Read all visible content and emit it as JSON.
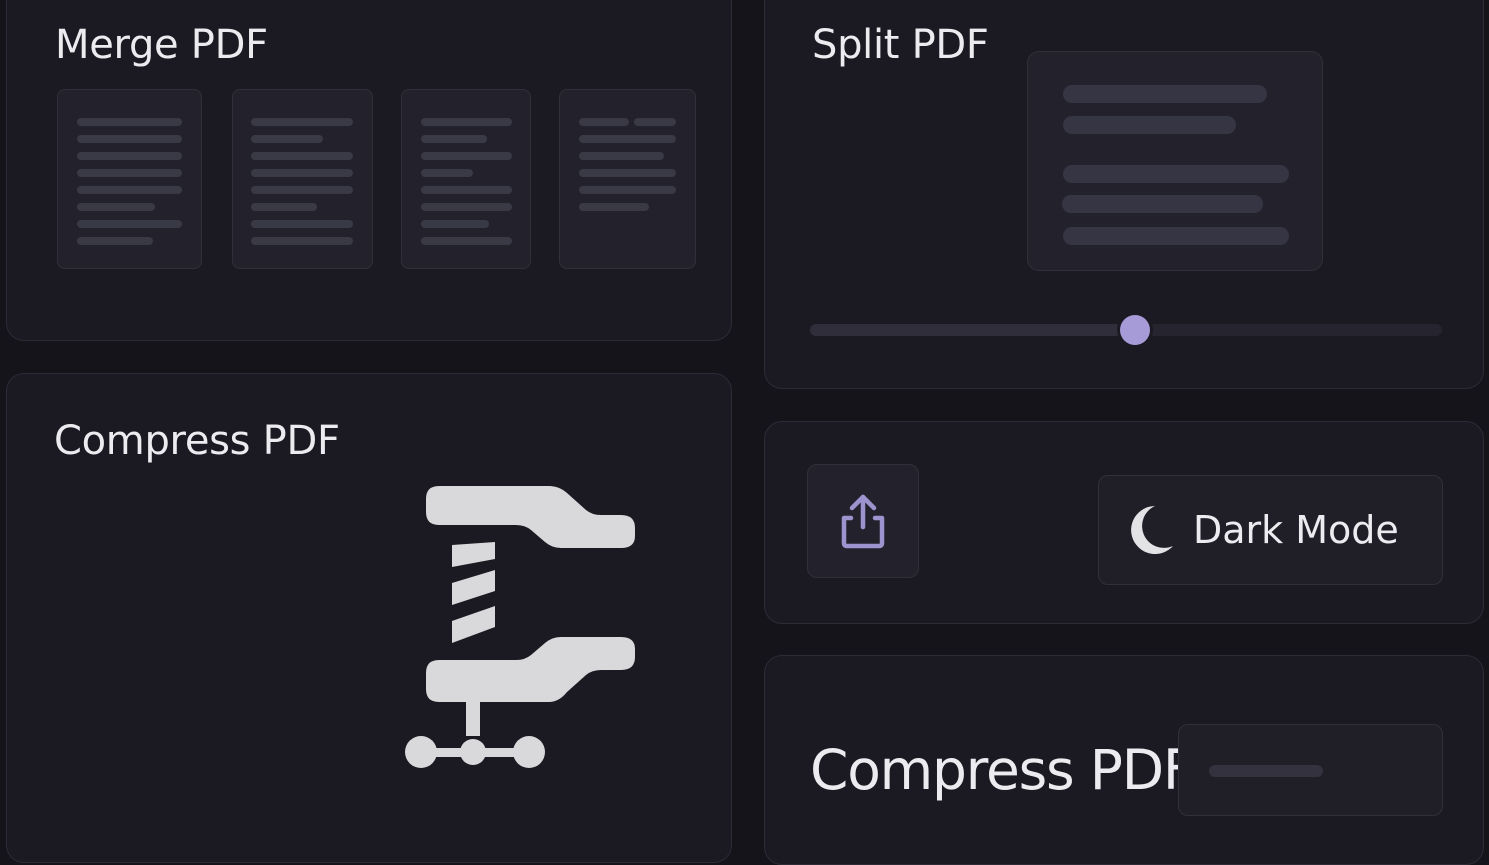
{
  "merge": {
    "title": "Merge PDF"
  },
  "split": {
    "title": "Split PDF",
    "slider_value_fraction": 0.515
  },
  "actions": {
    "share_icon": "share-upload-icon",
    "dark_mode_icon": "moon-icon",
    "dark_mode_label": "Dark Mode"
  },
  "compress": {
    "title": "Compress PDF",
    "icon": "clamp-compress-icon"
  },
  "compress_footer": {
    "title": "Compress PDF"
  },
  "colors": {
    "background": "#15141b",
    "card": "#1b1a22",
    "accent": "#a69bd6",
    "text": "#ececf0"
  }
}
